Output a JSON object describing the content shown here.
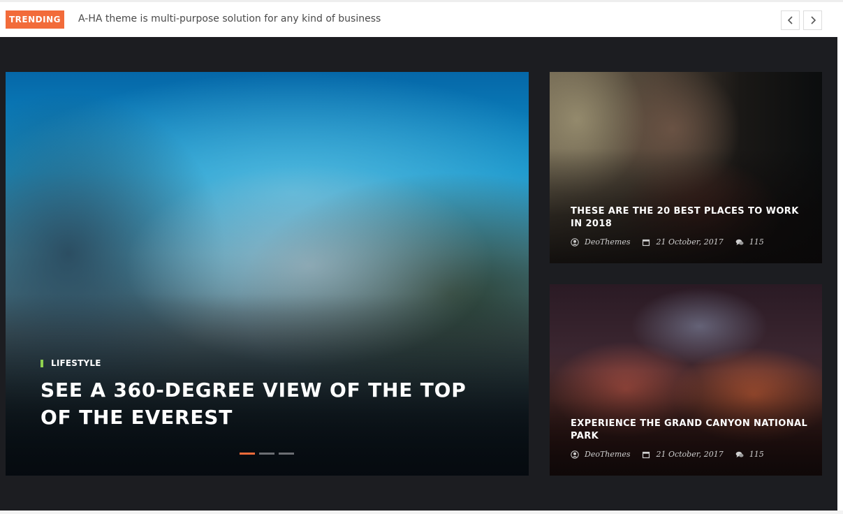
{
  "trending": {
    "label": "TRENDING",
    "text": "A-HA theme is multi-purpose solution for any kind of business",
    "prev_icon": "chevron-left-icon",
    "next_icon": "chevron-right-icon"
  },
  "colors": {
    "accent": "#f26b3a",
    "category_marker": "#8fd14f",
    "background_dark": "#1c1d21"
  },
  "main_post": {
    "category": "LIFESTYLE",
    "title": "SEE A 360-DEGREE VIEW OF THE TOP OF THE EVEREST",
    "slider": {
      "total": 3,
      "active": 1
    }
  },
  "side_posts": [
    {
      "title": "THESE ARE THE 20 BEST PLACES TO WORK IN 2018",
      "author": "DeoThemes",
      "date": "21 October, 2017",
      "comments": "115"
    },
    {
      "title": "EXPERIENCE THE GRAND CANYON NATIONAL PARK",
      "author": "DeoThemes",
      "date": "21 October, 2017",
      "comments": "115"
    }
  ]
}
